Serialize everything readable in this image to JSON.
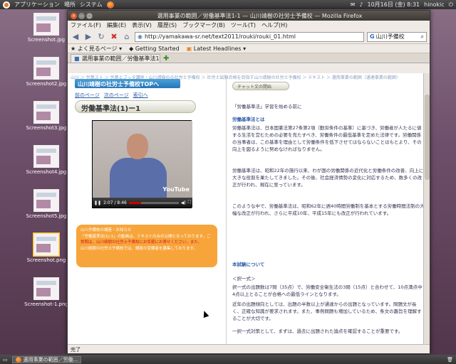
{
  "top_panel": {
    "menus": [
      "アプリケーション",
      "場所",
      "システム"
    ],
    "clock": "10月16日 (金) 8:31",
    "user": "hinokic"
  },
  "desktop_icons": [
    {
      "label": "Screenshot.jpg"
    },
    {
      "label": "Screenshot2.jpg"
    },
    {
      "label": "Screenshot3.jpg"
    },
    {
      "label": "Screenshot4.jpg"
    },
    {
      "label": "Screenshot5.jpg"
    },
    {
      "label": "Screenshot.png"
    },
    {
      "label": "Screenshot-1.png"
    }
  ],
  "window": {
    "title": "選用事業の範囲／労働基準法1-1 — 山川靖樹の社労士予備校 — Mozilla Firefox",
    "menu": [
      "ファイル(F)",
      "編集(E)",
      "表示(V)",
      "履歴(S)",
      "ブックマーク(B)",
      "ツール(T)",
      "ヘルプ(H)"
    ],
    "url": "http://yamakawa-sr.net/text2011/rouki/rouki_01.html",
    "search_value": "山川予備校",
    "bookmarks": [
      "よく見るページ",
      "Getting Started",
      "Latest Headlines"
    ],
    "tab_label": "選用事業の範囲／労働基準法1-1",
    "breadcrumb": "山川 ＞ 労基スト ＞ 労基とブッタ講座・山川靖樹のの社労士予備校 ＞ 社労士試験合格を目指す山川靖樹の社労士予備校 ＞ テキスト ＞ 選用事業の範囲（通達事業の範囲）",
    "status": "完了"
  },
  "page": {
    "top_link": "山川靖樹の社労士予備校TOPへ",
    "subnav": [
      "前のページ",
      "次のページ",
      "索引へ"
    ],
    "section_title": "労働基準法(1)ー1",
    "video": {
      "time": "2:07 / 8:46",
      "progress": 0.24,
      "logo": "YouTube"
    },
    "orange_box": {
      "line1": "山川予備校の講座・お知らせ",
      "line2": "「労働基準法(1)-1」の動画は、テキストのみの公開となっております。ご",
      "line3": "質問は、山川靖樹の社労士予備校にお気軽にお寄せください。また、",
      "line4": "山川靖樹の社労士予備校では、講座の受講者を募集しております。"
    },
    "chat_button": "チャット文の開始",
    "right_intro": "「労働基準法」学習を始める前に",
    "right_head1": "労働基準法とは",
    "right_para1": "労働基準法は、日本国憲法第27条第2項（勤労条件の基準）に基づき、労働者が人たるに値する生活を営むための必要を充たすべき、労働条件の最低基準を定めた法律です。労働関係の当事者は、この基準を理由として労働条件を低下させてはならないことはもとより、その向上を図るように努めなければなりません。",
    "right_para2": "労働基準法は、昭和22年の施行以来、わが国の労働関係の近代化と労働条件の改善、向上に大きな役割を果たしてきました。その後、社会経済情勢の変化に対応するため、数多くの改正が行われ、現在に至っています。",
    "right_para3": "このような中で、労働基準法は、昭和62年に週40時間労働制を基本とする労働時間法制の大幅な改正が行われ、さらに平成10年、平成15年にも改正が行われています。",
    "right_head2": "本試験について",
    "right_sub2": "＜択一式＞",
    "right_para4": "択一式の出題数は7問（35点）で、労働安全衛生法の3問（15点）と合わせて、10点満点中4点以上とることが合格への最低ラインとなります。",
    "right_para5": "近年の出題傾向としては、出題の半数以上が通達からの出題となっています。問題文が長く、正確な知識が要求されます。また、事例問題も増加しているため、条文の趣旨を理解することが大切です。",
    "right_para6": "一択一式対策として、まずは、過去に出題された論点を確認することが重要です。"
  },
  "taskbar": {
    "item": "選用事業の範囲／労働..."
  }
}
